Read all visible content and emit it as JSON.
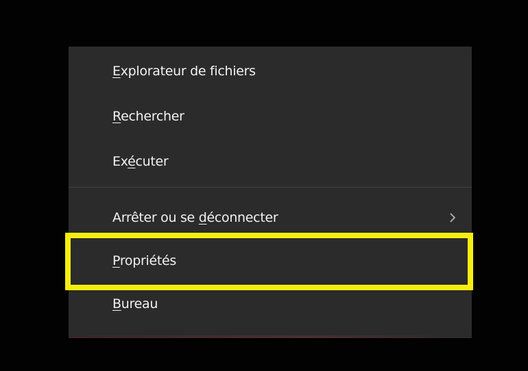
{
  "menu": {
    "items": [
      {
        "id": "file-explorer",
        "accel": "E",
        "rest": "xplorateur de fichiers"
      },
      {
        "id": "search",
        "accel": "R",
        "rest": "echercher"
      },
      {
        "id": "run",
        "pre": "Ex",
        "accel": "é",
        "rest": "cuter"
      },
      {
        "id": "shutdown",
        "pre": "Arrêter ou se ",
        "accel": "d",
        "rest": "éconnecter",
        "has_submenu": true
      },
      {
        "id": "properties",
        "accel": "P",
        "rest": "ropriétés"
      },
      {
        "id": "desktop",
        "accel": "B",
        "rest": "ureau"
      }
    ],
    "submenu_icon": "chevron-right-icon"
  },
  "highlight": {
    "target": "properties",
    "color": "#f5ee10"
  },
  "colors": {
    "background": "#020202",
    "menu_background": "#2b2b2b",
    "text": "#f2f2f2",
    "separator": "#454545"
  }
}
